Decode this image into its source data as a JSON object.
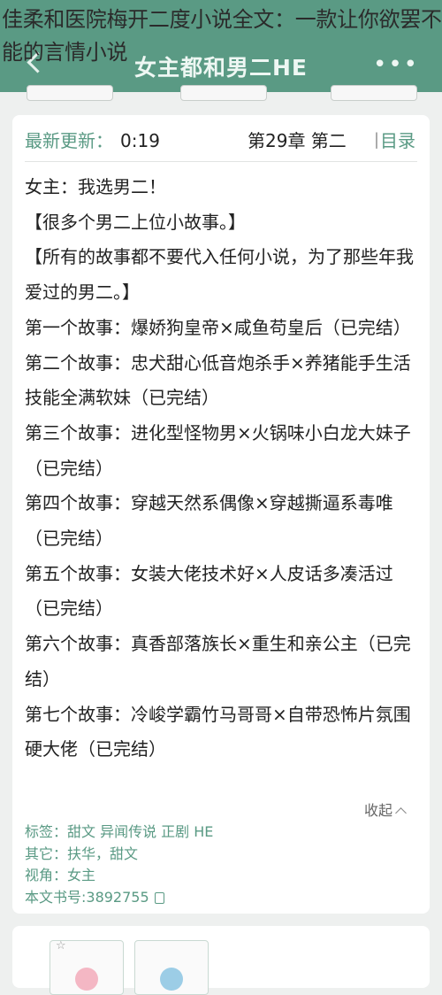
{
  "overlay_title": "佳柔和医院梅开二度小说全文：一款让你欲罢不能的言情小说",
  "header": {
    "title": "女主都和男二HE",
    "back_icon": "chevron-left-icon",
    "more_icon": "more-dots-icon",
    "more_glyph": "•••"
  },
  "update": {
    "label": "最新更新：",
    "time": "0:19",
    "chapter": "第29章  第二",
    "separator": "丨",
    "toc_label": "目录"
  },
  "intro": [
    "女主：我选男二！",
    "【很多个男二上位小故事。】",
    "【所有的故事都不要代入任何小说，为了那些年我爱过的男二。】",
    "第一个故事：爆娇狗皇帝×咸鱼苟皇后（已完结）",
    "第二个故事：忠犬甜心低音炮杀手×养猪能手生活技能全满软妹（已完结）",
    "第三个故事：进化型怪物男×火锅味小白龙大妹子（已完结）",
    "第四个故事：穿越天然系偶像×穿越撕逼系毒唯（已完结）",
    "第五个故事：女装大佬技术好×人皮话多凑活过（已完结）",
    "第六个故事：真香部落族长×重生和亲公主（已完结）",
    "第七个故事：冷峻学霸竹马哥哥×自带恐怖片氛围硬大佬（已完结）"
  ],
  "collapse_label": "收起",
  "meta": {
    "tags": "标签：甜文 异闻传说 正剧 HE",
    "others": "其它：扶华，甜文",
    "pov": "视角：女主",
    "book_id": "本文书号:3892755"
  },
  "colors": {
    "accent": "#5a9a84",
    "topbar": "#5a9a84",
    "background": "#eef0ef"
  }
}
